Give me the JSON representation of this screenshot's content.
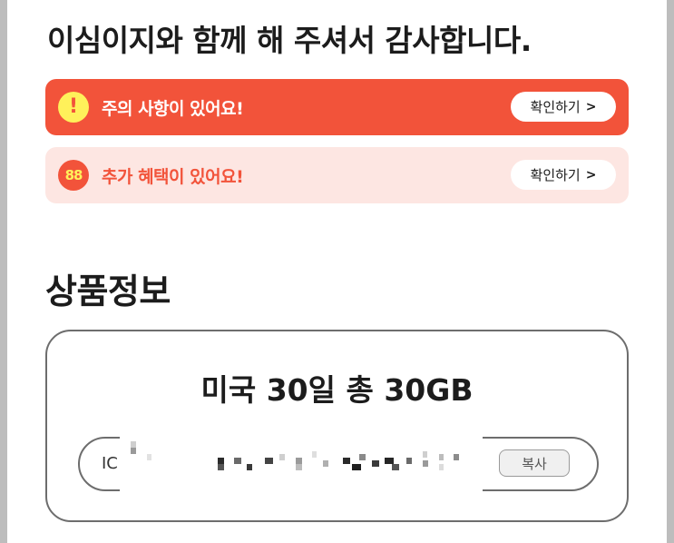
{
  "header": {
    "title": "이심이지와 함께 해 주셔서 감사합니다."
  },
  "notices": [
    {
      "icon": "exclamation-icon",
      "icon_glyph": "!",
      "text": "주의 사항이 있어요!",
      "button": "확인하기",
      "chevron": ">",
      "bg_color": "#f2533a"
    },
    {
      "icon": "coupon-icon",
      "icon_glyph": "88",
      "text": "추가 혜택이 있어요!",
      "button": "확인하기",
      "chevron": ">",
      "bg_color": "#fde6e2"
    }
  ],
  "product": {
    "section_title": "상품정보",
    "name": "미국 30일 총 30GB",
    "id_label": "IC",
    "copy_button": "복사"
  },
  "colors": {
    "accent": "#f2533a",
    "accent_light": "#fde6e2",
    "icon_yellow": "#fff15a"
  }
}
